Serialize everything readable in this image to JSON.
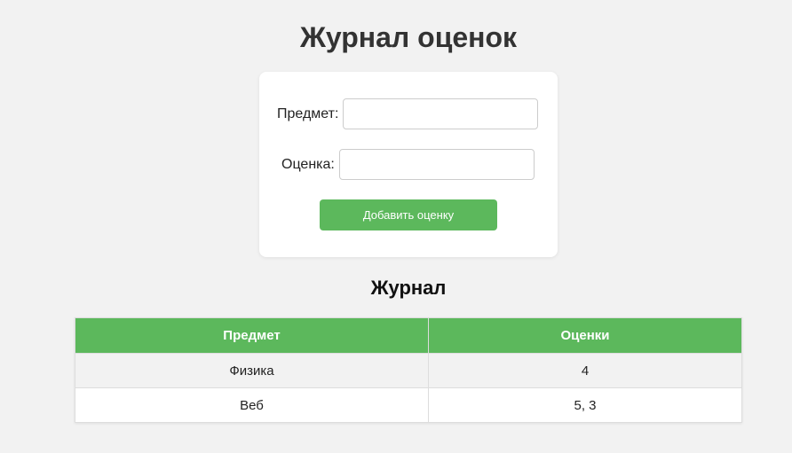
{
  "page": {
    "title": "Журнал оценок"
  },
  "form": {
    "subject_label": "Предмет:",
    "subject_value": "",
    "grade_label": "Оценка:",
    "grade_value": "",
    "add_button_label": "Добавить оценку"
  },
  "journal": {
    "title": "Журнал",
    "columns": [
      "Предмет",
      "Оценки"
    ],
    "rows": [
      {
        "subject": "Физика",
        "grades": "4"
      },
      {
        "subject": "Веб",
        "grades": "5, 3"
      }
    ]
  },
  "colors": {
    "accent": "#5cb85c",
    "background": "#f2f2f2"
  }
}
